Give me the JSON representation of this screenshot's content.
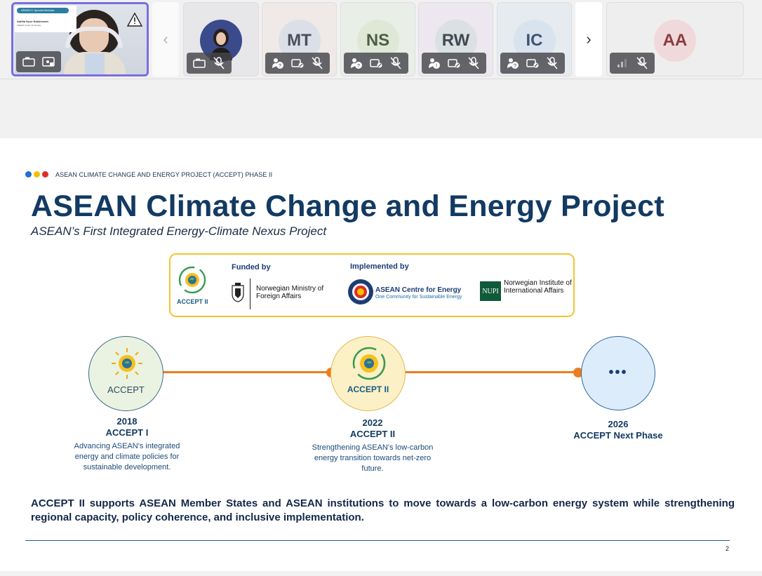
{
  "colors": {
    "accent_purple": "#7a6ee0",
    "timeline_orange": "#ee7c1c",
    "title_navy": "#123a63",
    "frame_yellow": "#f2c530",
    "dot_blue": "#1f6fd0",
    "dot_yellow": "#f2c200",
    "dot_red": "#e02a2a"
  },
  "presenter": {
    "badge_title": "ARMECC Special Webinar",
    "speaker_name": "Aalifia Noor Rakhiemah",
    "speaker_org": "ASEAN Centre for Energy",
    "icons": [
      "warning-icon",
      "camera-icon",
      "share-screen-icon"
    ]
  },
  "participants": [
    {
      "initials": "",
      "kind": "photo",
      "icons": [
        "camera-off-icon",
        "mic-muted-icon"
      ]
    },
    {
      "initials": "MT",
      "avatar_bg": "#dcdfe7",
      "avatar_fg": "#4a4f5e",
      "icons": [
        "raised-hand-icon",
        "camera-off-icon",
        "mic-muted-icon"
      ]
    },
    {
      "initials": "NS",
      "avatar_bg": "#dfe8d7",
      "avatar_fg": "#4c5d43",
      "icons": [
        "raised-hand-icon",
        "camera-off-icon",
        "mic-muted-icon"
      ]
    },
    {
      "initials": "RW",
      "avatar_bg": "#dbe0e2",
      "avatar_fg": "#404a52",
      "icons": [
        "raised-hand-icon",
        "camera-off-icon",
        "mic-muted-icon"
      ]
    },
    {
      "initials": "IC",
      "avatar_bg": "#d9e3ee",
      "avatar_fg": "#3d5570",
      "icons": [
        "raised-hand-icon",
        "camera-off-icon",
        "mic-muted-icon"
      ]
    },
    {
      "initials": "AA",
      "avatar_bg": "#f0d9da",
      "avatar_fg": "#8b3b3f",
      "icons": [
        "signal-icon",
        "mic-muted-icon"
      ]
    }
  ],
  "nav": {
    "prev": "‹",
    "next": "›"
  },
  "slide": {
    "kicker": "ASEAN CLIMATE CHANGE AND ENERGY PROJECT (ACCEPT) PHASE II",
    "title": "ASEAN Climate Change and Energy Project",
    "subtitle": "ASEAN’s First Integrated Energy-Climate Nexus Project",
    "partners": {
      "accept_logo_text": "ACCEPT II",
      "funded_by": "Funded by",
      "implemented_by": "Implemented by",
      "norway_name": "Norwegian Ministry of Foreign Affairs",
      "ace_name": "ASEAN Centre for Energy",
      "ace_tagline": "One Community for Sustainable Energy",
      "npi_abbr": "NUPI",
      "npi_name": "Norwegian Institute of International Affairs"
    },
    "timeline": [
      {
        "year": "2018",
        "phase": "ACCEPT I",
        "logo_text": "ACCEPT",
        "desc": "Advancing ASEAN's integrated energy and climate policies for sustainable development."
      },
      {
        "year": "2022",
        "phase": "ACCEPT II",
        "logo_text": "ACCEPT II",
        "desc": "Strengthening ASEAN's low-carbon energy transition towards net-zero future."
      },
      {
        "year": "2026",
        "phase": "ACCEPT Next Phase",
        "logo_text": "•••",
        "desc": ""
      }
    ],
    "summary": "ACCEPT II supports ASEAN Member States and ASEAN institutions to move towards a low-carbon energy system while strengthening regional capacity, policy coherence, and inclusive implementation.",
    "page_number": "2"
  }
}
